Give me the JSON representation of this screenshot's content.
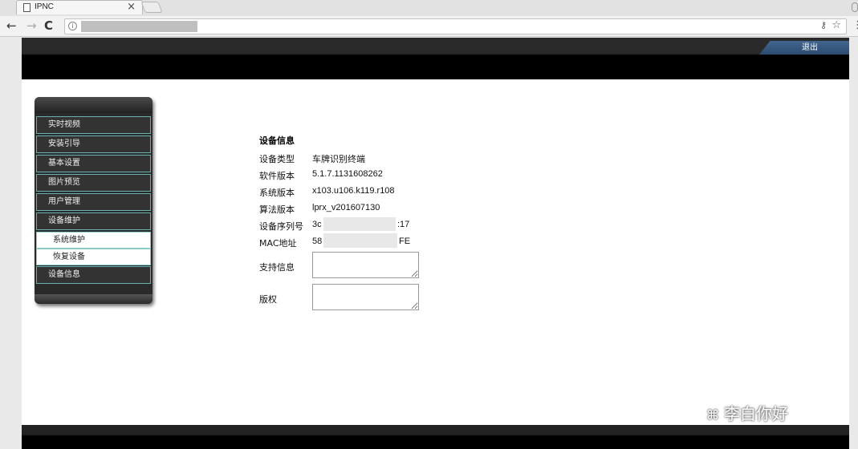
{
  "browser": {
    "tab_title": "IPNC",
    "tab_close": "×",
    "nav_back": "←",
    "nav_forward": "→",
    "nav_reload": "C",
    "info_glyph": "i",
    "key_glyph": "⚷",
    "star_glyph": "☆",
    "menu_glyph": "⋮"
  },
  "header": {
    "logout_label": "退出"
  },
  "sidebar": {
    "items": [
      {
        "label": "实时视频"
      },
      {
        "label": "安装引导"
      },
      {
        "label": "基本设置"
      },
      {
        "label": "图片预览"
      },
      {
        "label": "用户管理"
      },
      {
        "label": "设备维护"
      }
    ],
    "subitems": [
      {
        "label": "系统维护"
      },
      {
        "label": "恢复设备"
      }
    ],
    "last_item": {
      "label": "设备信息"
    }
  },
  "device_info": {
    "title": "设备信息",
    "rows": [
      {
        "label": "设备类型",
        "value": "车牌识别终端"
      },
      {
        "label": "软件版本",
        "value": "5.1.7.1131608262"
      },
      {
        "label": "系统版本",
        "value": "x103.u106.k119.r108"
      },
      {
        "label": "算法版本",
        "value": "lprx_v201607130"
      },
      {
        "label": "设备序列号",
        "value_prefix": "3c",
        "value_suffix": ":17"
      },
      {
        "label": "MAC地址",
        "value_prefix": "58",
        "value_suffix": "FE"
      }
    ],
    "support_label": "支持信息",
    "support_value": "",
    "copyright_label": "版权",
    "copyright_value": ""
  },
  "watermark": {
    "icon": "⌘",
    "text": "李白你好"
  }
}
